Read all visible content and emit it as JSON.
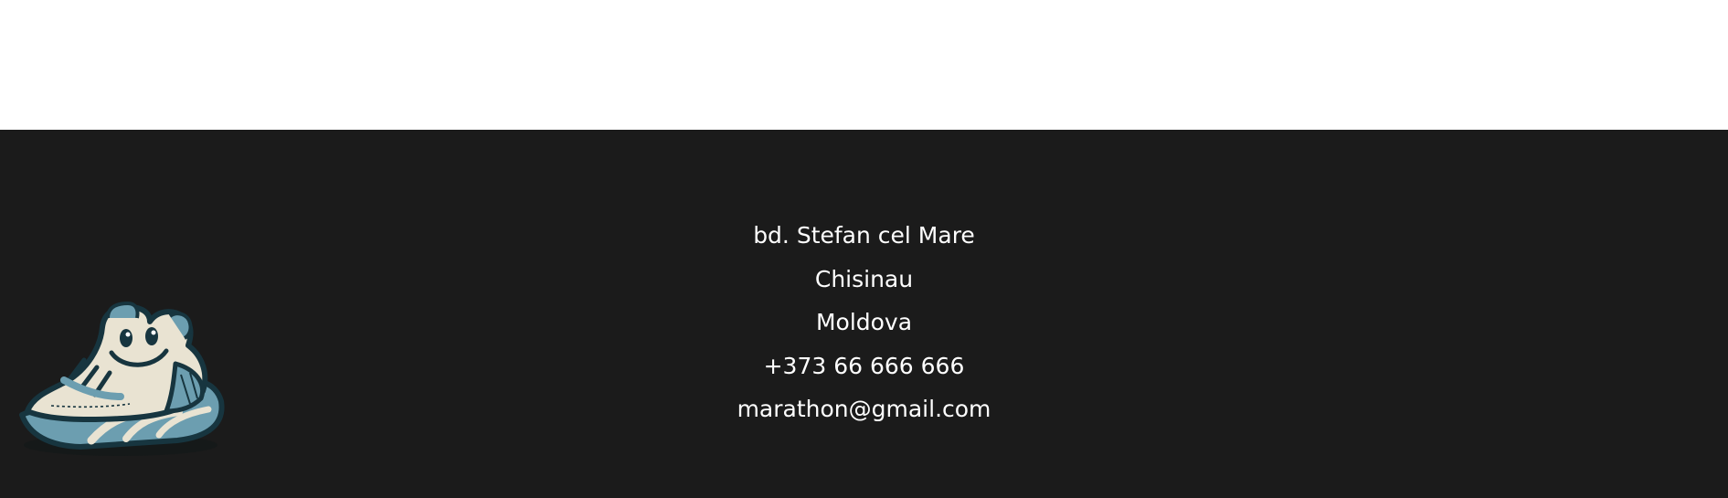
{
  "footer": {
    "logo": {
      "icon": "smiling-sneaker-logo",
      "alt": ""
    },
    "contact": {
      "street": "bd. Stefan cel Mare",
      "city": "Chisinau",
      "country": "Moldova",
      "phone": "+373 66 666 666",
      "email": "marathon@gmail.com"
    }
  },
  "colors": {
    "footer_background": "#1b1b1b",
    "page_background": "#ffffff",
    "text": "#ffffff",
    "logo_blue": "#6c9eb0",
    "logo_cream": "#e9e3d2",
    "logo_outline": "#17353f"
  }
}
